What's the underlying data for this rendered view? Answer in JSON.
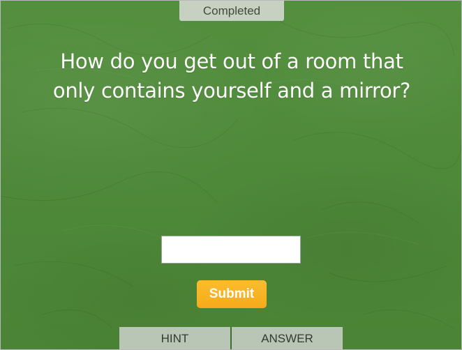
{
  "status": {
    "label": "Completed"
  },
  "question": {
    "line1": "How do you get out of a room that",
    "line2": "only contains yourself and a mirror?"
  },
  "answer_input": {
    "value": "",
    "placeholder": ""
  },
  "submit": {
    "label": "Submit"
  },
  "tabs": {
    "hint_label": "HINT",
    "answer_label": "ANSWER"
  },
  "colors": {
    "background": "#4f8a3a",
    "submit_button": "#f7b223",
    "tab_background": "#b9c6b5",
    "status_background": "#c7d1c2"
  }
}
